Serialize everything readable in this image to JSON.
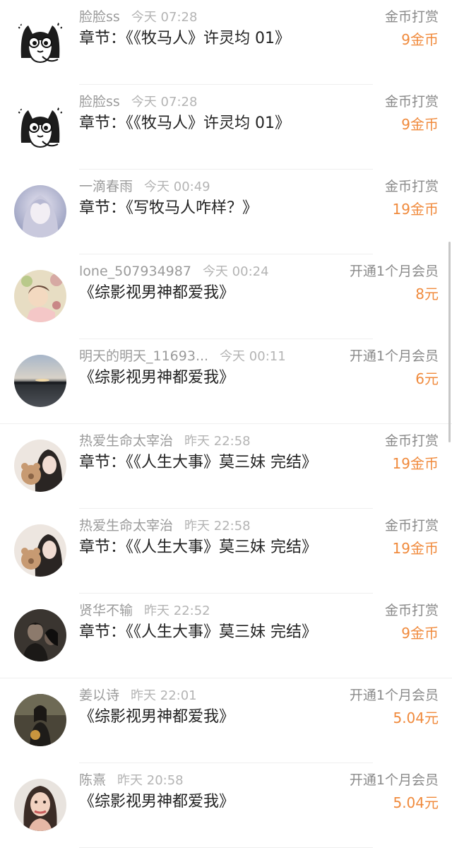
{
  "accent_color": "#f08a3c",
  "entries": [
    {
      "name": "脸脸ss",
      "time": "今天 07:28",
      "title": "章节：《《牧马人》许灵均 01》",
      "type": "金币打赏",
      "amount": "9金币",
      "avatar": "cat-avatar"
    },
    {
      "name": "脸脸ss",
      "time": "今天 07:28",
      "title": "章节：《《牧马人》许灵均 01》",
      "type": "金币打赏",
      "amount": "9金币",
      "avatar": "cat-avatar"
    },
    {
      "name": "一滴春雨",
      "time": "今天 00:49",
      "title": "章节：《写牧马人咋样？》",
      "type": "金币打赏",
      "amount": "19金币",
      "avatar": "anime-girl-avatar"
    },
    {
      "name": "lone_507934987",
      "time": "今天 00:24",
      "title": "《综影视男神都爱我》",
      "type": "开通1个月会员",
      "amount": "8元",
      "avatar": "illustration-avatar"
    },
    {
      "name": "明天的明天_11693...",
      "time": "今天 00:11",
      "title": "《综影视男神都爱我》",
      "type": "开通1个月会员",
      "amount": "6元",
      "avatar": "sunset-lake-avatar"
    },
    {
      "name": "热爱生命太宰治",
      "time": "昨天 22:58",
      "title": "章节：《《人生大事》莫三妹 完结》",
      "type": "金币打赏",
      "amount": "19金币",
      "avatar": "girl-with-bear-avatar"
    },
    {
      "name": "热爱生命太宰治",
      "time": "昨天 22:58",
      "title": "章节：《《人生大事》莫三妹 完结》",
      "type": "金币打赏",
      "amount": "19金币",
      "avatar": "girl-with-bear-avatar"
    },
    {
      "name": "贤华不输",
      "time": "昨天 22:52",
      "title": "章节：《《人生大事》莫三妹 完结》",
      "type": "金币打赏",
      "amount": "9金币",
      "avatar": "dark-couple-avatar"
    },
    {
      "name": "姜以诗",
      "time": "昨天 22:01",
      "title": "《综影视男神都爱我》",
      "type": "开通1个月会员",
      "amount": "5.04元",
      "avatar": "woman-dark-avatar"
    },
    {
      "name": "陈熹",
      "time": "昨天 20:58",
      "title": "《综影视男神都爱我》",
      "type": "开通1个月会员",
      "amount": "5.04元",
      "avatar": "woman-portrait-avatar"
    }
  ]
}
